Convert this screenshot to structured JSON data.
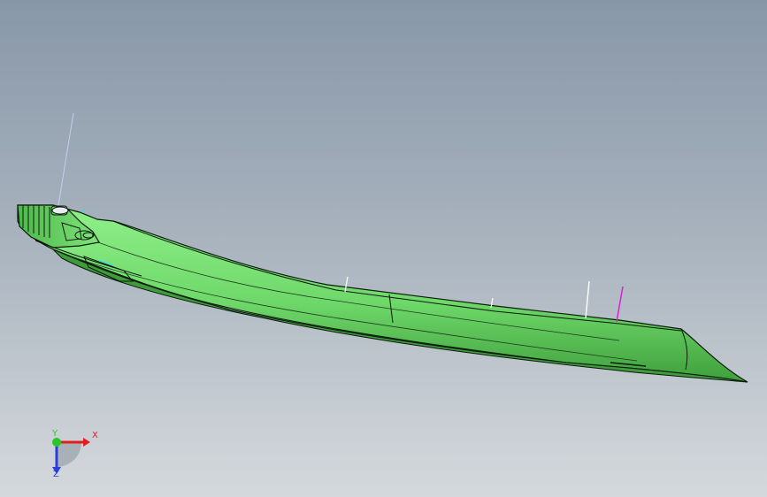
{
  "colors": {
    "background_top": "#8897a8",
    "background_bottom": "#d5d9dd",
    "part_fill": "#7fe37a",
    "part_shade": "#3fa33c",
    "edge_line": "#0a1a0a",
    "x_axis": "#e01e1e",
    "y_axis": "#28c828",
    "z_axis": "#2a3ee0",
    "sketch_plane": "#d02cd0",
    "reference_axis": "#ffffff"
  },
  "triad": {
    "x_label": "X",
    "y_label": "Y",
    "z_label": "Z"
  },
  "icons": {
    "triad": "coordinate-triad-icon"
  }
}
